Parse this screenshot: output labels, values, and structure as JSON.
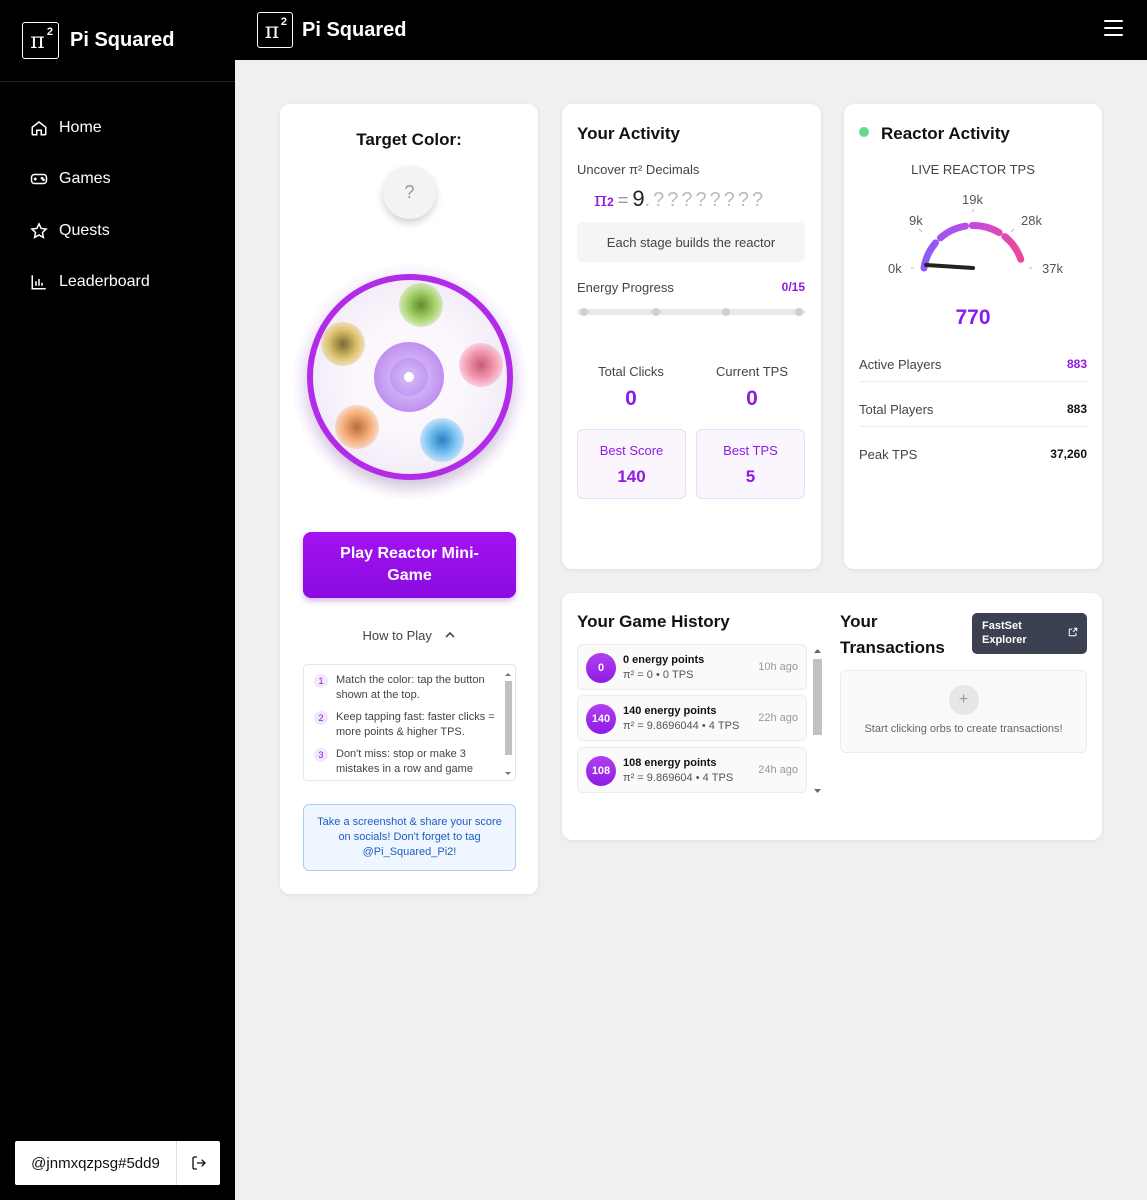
{
  "app": {
    "name": "Pi Squared",
    "logo_symbol": "π",
    "logo_sup": "2"
  },
  "nav": {
    "items": [
      {
        "label": "Home",
        "icon": "home-icon"
      },
      {
        "label": "Games",
        "icon": "gamepad-icon"
      },
      {
        "label": "Quests",
        "icon": "star-icon"
      },
      {
        "label": "Leaderboard",
        "icon": "bar-chart-icon"
      }
    ]
  },
  "user": {
    "handle": "@jnmxqzpsg#5dd9"
  },
  "target": {
    "title": "Target Color:",
    "swatch_text": "?",
    "play_label": "Play Reactor Mini-Game",
    "howto_label": "How to Play",
    "steps": [
      {
        "num": "1",
        "text": "Match the color: tap the button shown at the top."
      },
      {
        "num": "2",
        "text": "Keep tapping fast: faster clicks = more points & higher TPS."
      },
      {
        "num": "3",
        "text": "Don't miss: stop or make 3 mistakes in a row and game"
      }
    ],
    "share_text": "Take a screenshot & share your score on socials! Don't forget to tag @Pi_Squared_Pi2!"
  },
  "activity": {
    "title": "Your Activity",
    "uncover_label": "Uncover π² Decimals",
    "pi_symbol": "π",
    "pi_sup": "2",
    "equals": "=",
    "integer": "9",
    "decimals": ".????????",
    "stage_text": "Each stage builds the reactor",
    "energy_label": "Energy Progress",
    "energy_count": "0/15",
    "energy_fraction": 0,
    "total_clicks_label": "Total Clicks",
    "total_clicks": "0",
    "current_tps_label": "Current TPS",
    "current_tps": "0",
    "best_score_label": "Best Score",
    "best_score": "140",
    "best_tps_label": "Best TPS",
    "best_tps": "5"
  },
  "reactor": {
    "title": "Reactor Activity",
    "live_label": "LIVE REACTOR TPS",
    "gauge_ticks": [
      "0k",
      "9k",
      "19k",
      "28k",
      "37k"
    ],
    "gauge_value": "770",
    "gauge_max": 37260,
    "gauge_current": 770,
    "active_players_label": "Active Players",
    "active_players": "883",
    "total_players_label": "Total Players",
    "total_players": "883",
    "peak_tps_label": "Peak TPS",
    "peak_tps": "37,260",
    "colors": {
      "accent": "#8e1be4",
      "live": "#66d98b"
    }
  },
  "history": {
    "title": "Your Game History",
    "rows": [
      {
        "badge": "0",
        "title": "0 energy points",
        "sub": "π² = 0 • 0 TPS",
        "time": "10h ago"
      },
      {
        "badge": "140",
        "title": "140 energy points",
        "sub": "π² = 9.8696044 • 4 TPS",
        "time": "22h ago"
      },
      {
        "badge": "108",
        "title": "108 energy points",
        "sub": "π² = 9.869604 • 4 TPS",
        "time": "24h ago"
      }
    ]
  },
  "transactions": {
    "title_line1": "Your",
    "title_line2": "Transactions",
    "explorer_line1": "FastSet",
    "explorer_line2": "Explorer",
    "empty_icon": "+",
    "empty_text": "Start clicking orbs to create transactions!"
  }
}
